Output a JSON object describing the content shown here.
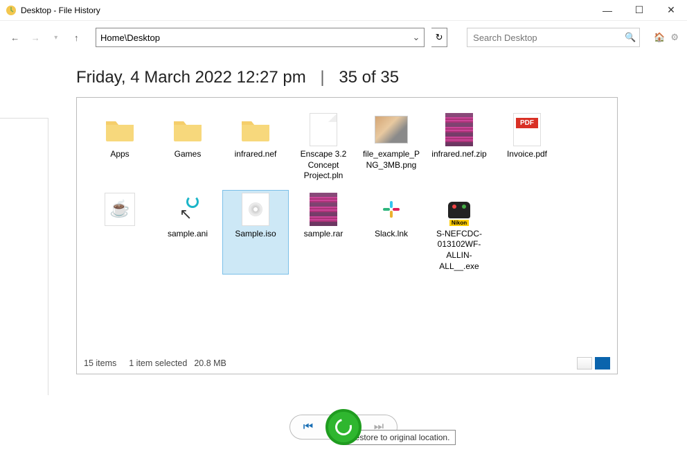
{
  "window": {
    "title": "Desktop - File History"
  },
  "nav": {
    "address": "Home\\Desktop",
    "search_placeholder": "Search Desktop"
  },
  "header": {
    "date": "Friday, 4 March 2022 12:27 pm",
    "counter": "35 of 35"
  },
  "files": [
    {
      "name": "Apps",
      "icon": "folder",
      "selected": false
    },
    {
      "name": "Games",
      "icon": "folder",
      "selected": false
    },
    {
      "name": "infrared.nef",
      "icon": "folder",
      "selected": false
    },
    {
      "name": "Enscape 3.2 Concept Project.pln",
      "icon": "blank",
      "selected": false
    },
    {
      "name": "file_example_PNG_3MB.png",
      "icon": "image",
      "selected": false
    },
    {
      "name": "infrared.nef.zip",
      "icon": "rar",
      "selected": false
    },
    {
      "name": "Invoice.pdf",
      "icon": "pdf",
      "selected": false
    },
    {
      "name": "",
      "icon": "java",
      "selected": false
    },
    {
      "name": "sample.ani",
      "icon": "cursor",
      "selected": false
    },
    {
      "name": "Sample.iso",
      "icon": "iso",
      "selected": true
    },
    {
      "name": "sample.rar",
      "icon": "rar",
      "selected": false
    },
    {
      "name": "Slack.lnk",
      "icon": "slack",
      "selected": false
    },
    {
      "name": "S-NEFCDC-013102WF-ALLIN-ALL__.exe",
      "icon": "nikon",
      "selected": false
    }
  ],
  "status": {
    "count": "15 items",
    "selected": "1 item selected",
    "size": "20.8 MB"
  },
  "tooltip": "Restore to original location."
}
